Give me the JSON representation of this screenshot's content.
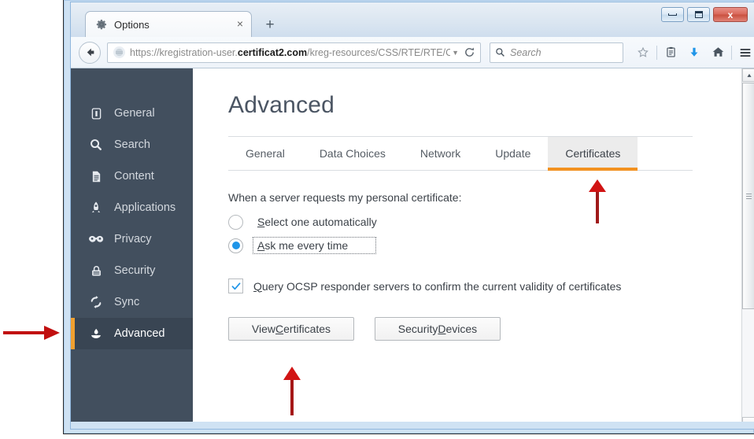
{
  "window": {
    "controls": {
      "minimize_label": "Minimize",
      "maximize_label": "Maximize",
      "close_label": "x"
    }
  },
  "tabstrip": {
    "tab": {
      "title": "Options",
      "icon": "gear-icon",
      "close_label": "×"
    },
    "new_tab_label": "+"
  },
  "navbar": {
    "back_label": "Back",
    "url_prefix": "https://kregistration-user.",
    "url_domain": "certificat2.com",
    "url_suffix": "/kreg-resources/CSS/RTE/RTE/Cer",
    "url_dropdown": "▼",
    "reload_label": "Reload",
    "search_placeholder": "Search",
    "icons": [
      "bookmark-star-icon",
      "library-icon",
      "download-icon",
      "home-icon",
      "menu-icon"
    ]
  },
  "sidebar": {
    "items": [
      {
        "label": "General",
        "icon": "general-icon",
        "active": false
      },
      {
        "label": "Search",
        "icon": "search-icon",
        "active": false
      },
      {
        "label": "Content",
        "icon": "content-icon",
        "active": false
      },
      {
        "label": "Applications",
        "icon": "applications-icon",
        "active": false
      },
      {
        "label": "Privacy",
        "icon": "privacy-mask-icon",
        "active": false
      },
      {
        "label": "Security",
        "icon": "security-lock-icon",
        "active": false
      },
      {
        "label": "Sync",
        "icon": "sync-icon",
        "active": false
      },
      {
        "label": "Advanced",
        "icon": "advanced-flask-icon",
        "active": true
      }
    ],
    "accent_color": "#f0a030",
    "background_color": "#424f5e"
  },
  "main": {
    "page_title": "Advanced",
    "tabs": [
      {
        "label": "General",
        "active": false
      },
      {
        "label": "Data Choices",
        "active": false
      },
      {
        "label": "Network",
        "active": false
      },
      {
        "label": "Update",
        "active": false
      },
      {
        "label": "Certificates",
        "active": true
      }
    ],
    "active_tab_underline_color": "#f29221",
    "section_label": "When a server requests my personal certificate:",
    "radios": [
      {
        "label_before": "S",
        "label_after": "elect one automatically",
        "checked": false,
        "focused": false
      },
      {
        "label_before": "A",
        "label_after": "sk me every time",
        "checked": true,
        "focused": true
      }
    ],
    "checkbox": {
      "label_before": "Q",
      "label_after": "uery OCSP responder servers to confirm the current validity of certificates",
      "checked": true,
      "check_color": "#1f95e8"
    },
    "buttons": [
      {
        "label_pre": "View ",
        "label_key": "C",
        "label_post": "ertificates"
      },
      {
        "label_pre": "Security ",
        "label_key": "D",
        "label_post": "evices"
      }
    ]
  },
  "scrollbar": {
    "up_label": "▲",
    "down_label": "▼"
  },
  "annotations": {
    "color": "#c10f0f",
    "arrows": [
      {
        "name": "arrow-to-advanced-sidebar",
        "direction": "right"
      },
      {
        "name": "arrow-to-certificates-tab",
        "direction": "up"
      },
      {
        "name": "arrow-to-view-certificates-button",
        "direction": "up"
      }
    ]
  }
}
